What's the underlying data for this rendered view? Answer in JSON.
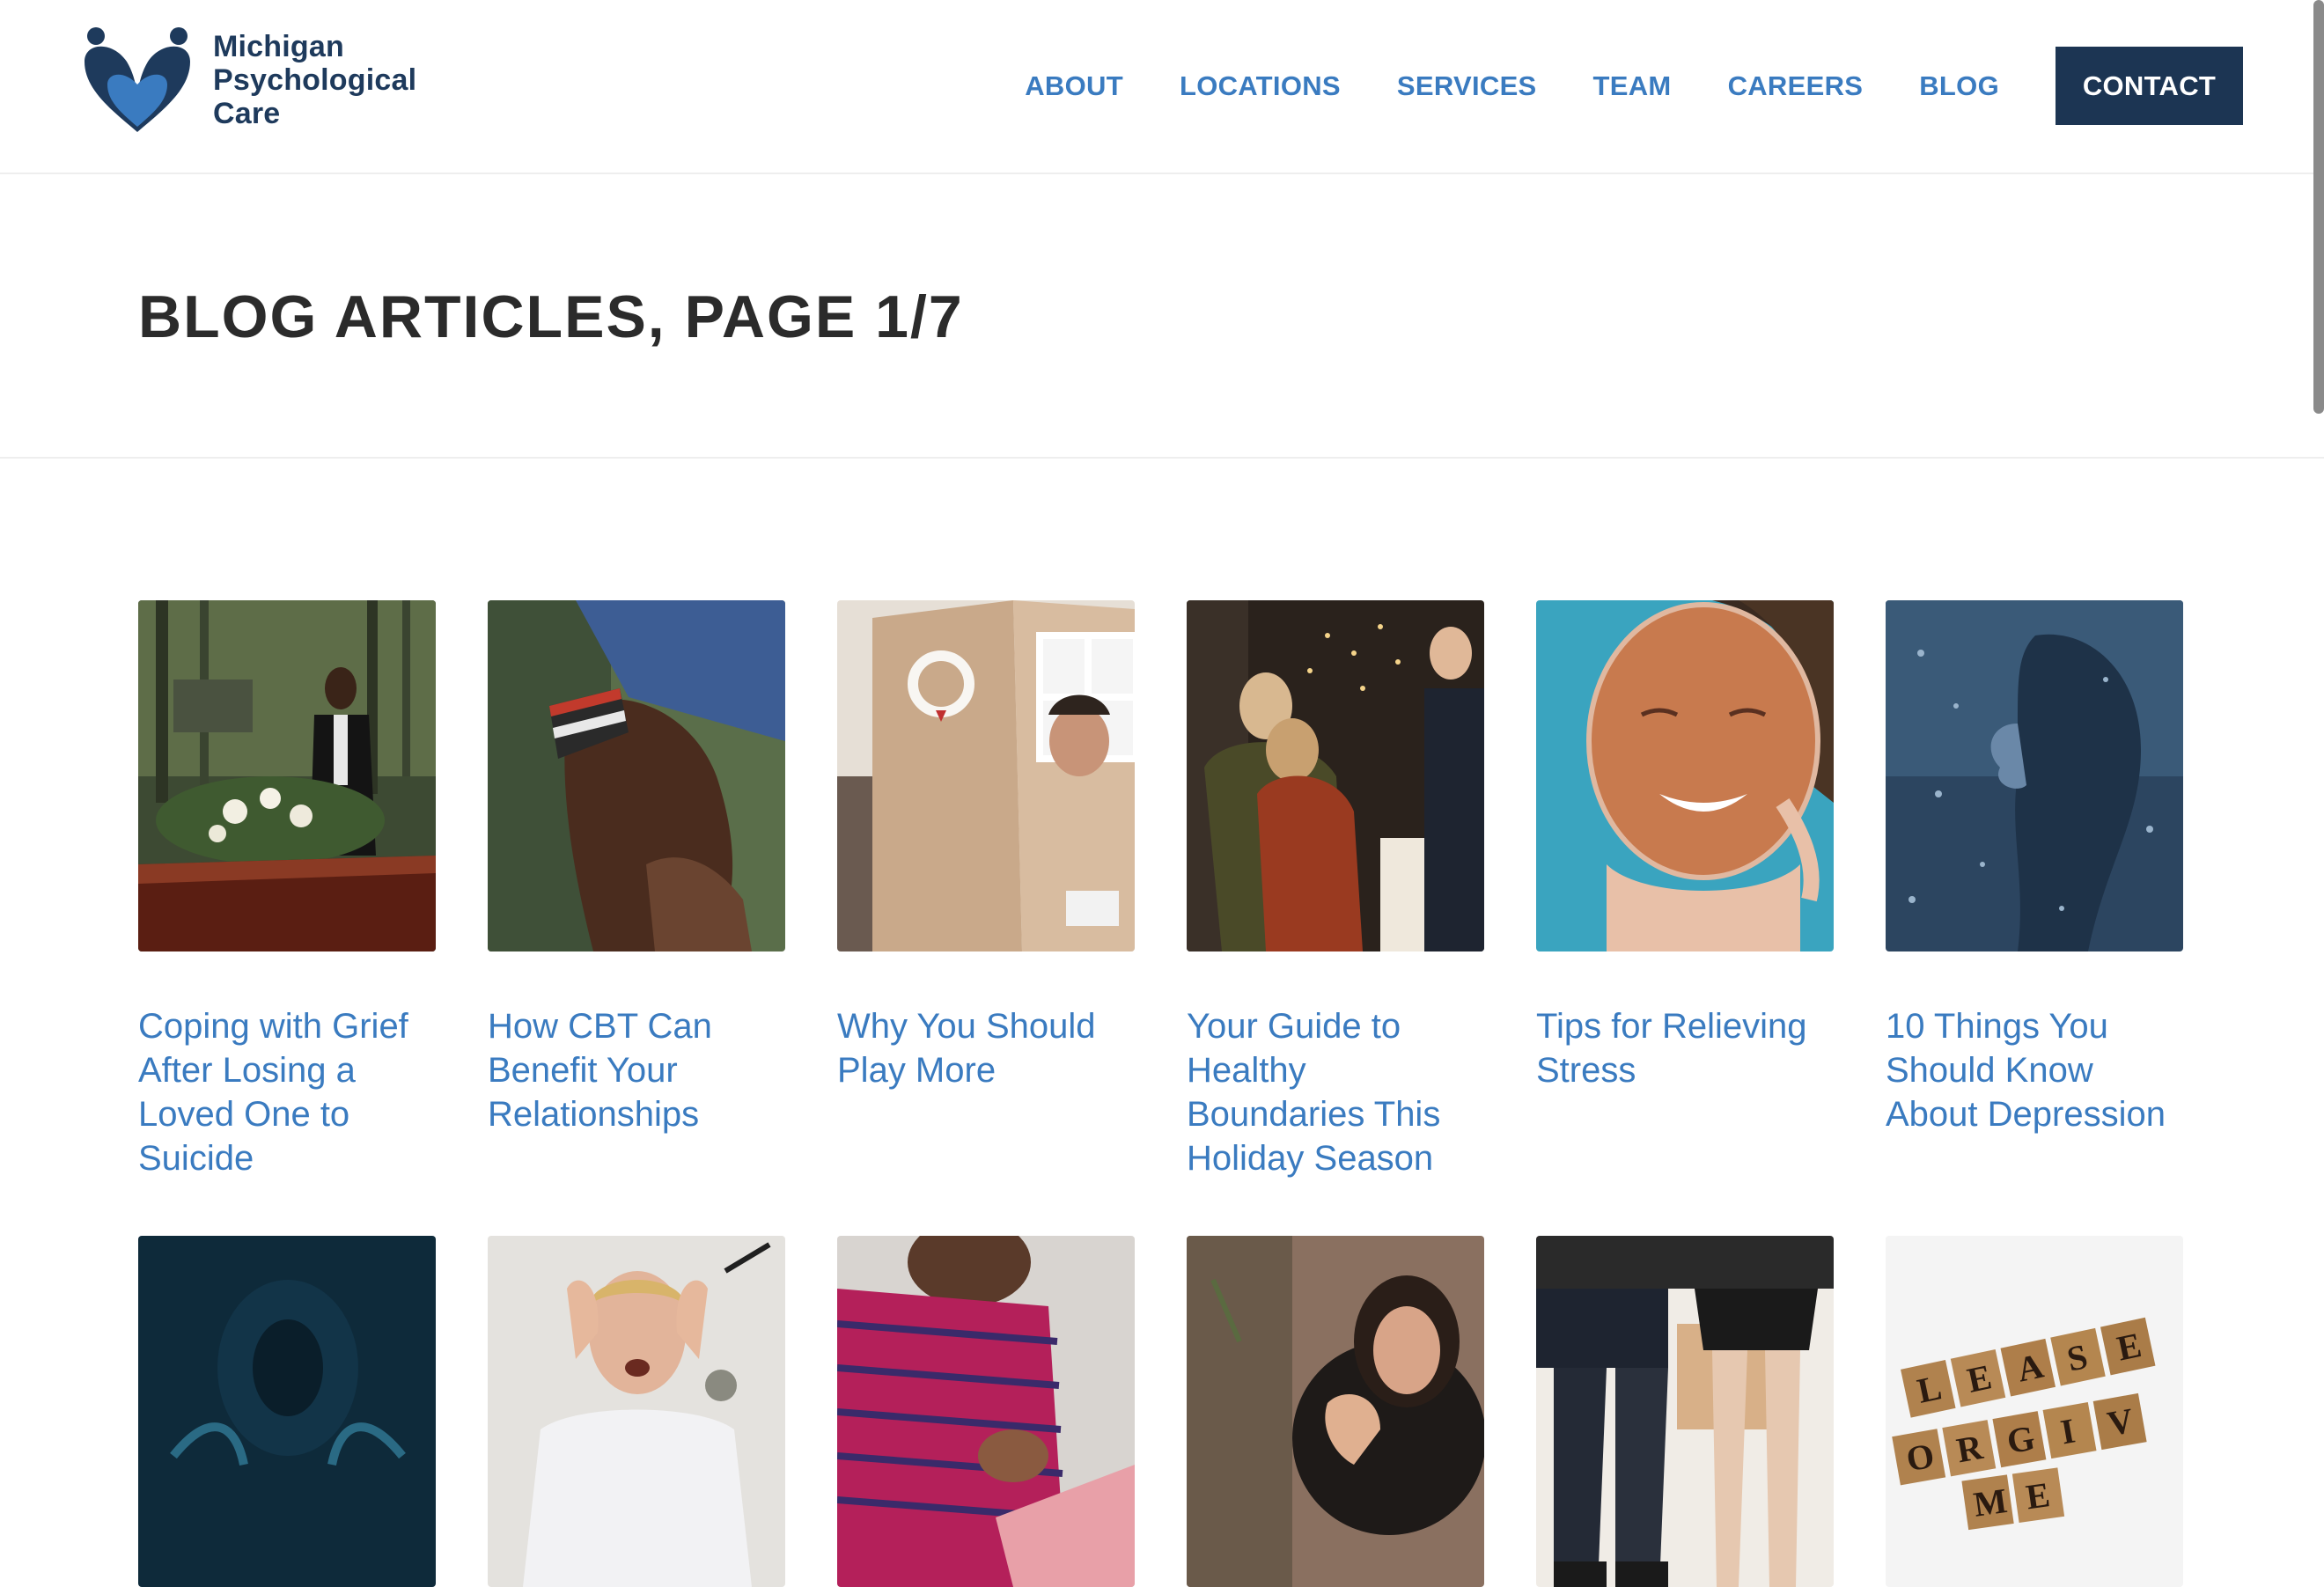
{
  "site": {
    "logo_lines": [
      "Michigan",
      "Psychological",
      "Care"
    ],
    "brand_color": "#1e3a5c",
    "accent_color": "#3a7bc0"
  },
  "nav": {
    "items": [
      {
        "label": "ABOUT"
      },
      {
        "label": "LOCATIONS"
      },
      {
        "label": "SERVICES"
      },
      {
        "label": "TEAM"
      },
      {
        "label": "CAREERS"
      },
      {
        "label": "BLOG"
      }
    ],
    "contact_label": "CONTACT"
  },
  "page": {
    "title": "BLOG ARTICLES, PAGE 1/7"
  },
  "posts": [
    {
      "title": "Coping with Grief After Losing a Loved One to Suicide",
      "image": "funeral-casket-photo"
    },
    {
      "title": "How CBT Can Benefit Your Relationships",
      "image": "holding-hands-photo"
    },
    {
      "title": "Why You Should Play More",
      "image": "cardboard-playhouse-photo"
    },
    {
      "title": "Your Guide to Healthy Boundaries This Holiday Season",
      "image": "holiday-hug-photo"
    },
    {
      "title": "Tips for Relieving Stress",
      "image": "face-mask-photo"
    },
    {
      "title": "10 Things You Should Know About Depression",
      "image": "rain-window-portrait-photo"
    },
    {
      "title": "",
      "image": "dark-silhouette-photo"
    },
    {
      "title": "",
      "image": "stressed-man-photo"
    },
    {
      "title": "",
      "image": "elderly-man-writing-photo"
    },
    {
      "title": "",
      "image": "woman-reaching-photo"
    },
    {
      "title": "",
      "image": "couple-sitting-photo"
    },
    {
      "title": "",
      "image": "scrabble-tiles-photo"
    }
  ],
  "scrabble_tiles": [
    "L",
    "E",
    "A",
    "S",
    "E",
    "O",
    "R",
    "G",
    "I",
    "V",
    "M",
    "E"
  ]
}
